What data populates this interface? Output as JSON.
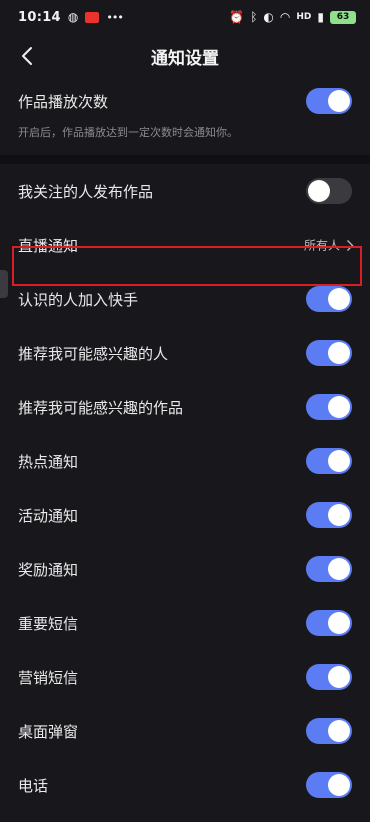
{
  "status_bar": {
    "time": "10:14",
    "left_dots": "•••",
    "wifi_text": "HD",
    "battery": "63"
  },
  "nav": {
    "title": "通知设置"
  },
  "settings": {
    "play_count": {
      "label": "作品播放次数",
      "enabled": true,
      "description": "开启后，作品播放达到一定次数时会通知你。"
    },
    "followed_posts": {
      "label": "我关注的人发布作品",
      "enabled": false
    },
    "live": {
      "label": "直播通知",
      "value": "所有人"
    },
    "acquaintance_join": {
      "label": "认识的人加入快手",
      "enabled": true
    },
    "recommend_people": {
      "label": "推荐我可能感兴趣的人",
      "enabled": true
    },
    "recommend_works": {
      "label": "推荐我可能感兴趣的作品",
      "enabled": true
    },
    "hot": {
      "label": "热点通知",
      "enabled": true
    },
    "activity": {
      "label": "活动通知",
      "enabled": true
    },
    "reward": {
      "label": "奖励通知",
      "enabled": true
    },
    "important_sms": {
      "label": "重要短信",
      "enabled": true
    },
    "marketing_sms": {
      "label": "营销短信",
      "enabled": true
    },
    "desktop_popup": {
      "label": "桌面弹窗",
      "enabled": true
    },
    "phone": {
      "label": "电话",
      "enabled": true
    }
  },
  "colors": {
    "background": "#18181c",
    "toggle_on": "#5b7cf2",
    "toggle_off": "#3a3a3f",
    "highlight": "#d91f26"
  }
}
